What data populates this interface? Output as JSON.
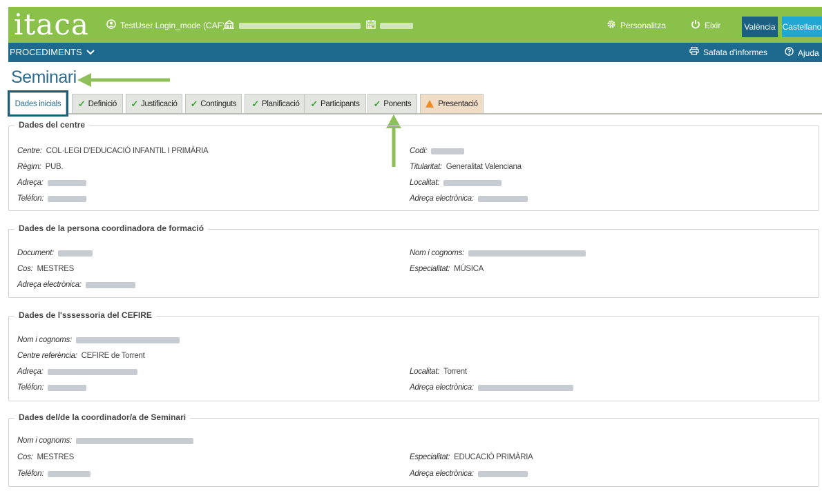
{
  "app": {
    "logo": "itaca",
    "user": "TestUser Login_mode (CAF)",
    "personalitza": "Personalitza",
    "eixir": "Eixir",
    "lang_active": "València",
    "lang_other": "Castellano",
    "brand_color": "#89c14a",
    "nav_color": "#1e6a8e"
  },
  "nav": {
    "procediments": "PROCEDIMENTS",
    "safata": "Safata d'informes",
    "ajuda": "Ajuda"
  },
  "page": {
    "title": "Seminari"
  },
  "tabs": [
    {
      "label": "Dades inicials",
      "state": "active"
    },
    {
      "label": "Definició",
      "state": "done"
    },
    {
      "label": "Justificació",
      "state": "done"
    },
    {
      "label": "Continguts",
      "state": "done"
    },
    {
      "label": "Planificació",
      "state": "done"
    },
    {
      "label": "Participants",
      "state": "done"
    },
    {
      "label": "Ponents",
      "state": "done"
    },
    {
      "label": "Presentació",
      "state": "warning"
    }
  ],
  "sections": {
    "centre": {
      "legend": "Dades del centre",
      "centre_label": "Centre:",
      "centre_value": "COL·LEGI D'EDUCACIÓ INFANTIL I PRIMÀRIA",
      "regim_label": "Règim:",
      "regim_value": "PUB.",
      "adreca_label": "Adreça:",
      "telefon_label": "Teléfon:",
      "codi_label": "Codi:",
      "titularitat_label": "Titularitat:",
      "titularitat_value": "Generalitat Valenciana",
      "localitat_label": "Localitat:",
      "email_label": "Adreça electrònica:"
    },
    "coordinadora": {
      "legend": "Dades de la persona coordinadora de formació",
      "document_label": "Document:",
      "cos_label": "Cos:",
      "cos_value": "MESTRES",
      "email_label": "Adreça electrònica:",
      "nom_label": "Nom i cognoms:",
      "especialitat_label": "Especialitat:",
      "especialitat_value": "MÚSICA"
    },
    "assessoria": {
      "legend": "Dades de l'sssessoria del CEFIRE",
      "nom_label": "Nom i cognoms:",
      "centre_ref_label": "Centre referència:",
      "centre_ref_value": "CEFIRE de Torrent",
      "adreca_label": "Adreça:",
      "telefon_label": "Teléfon:",
      "localitat_label": "Localitat:",
      "localitat_value": "Torrent",
      "email_label": "Adreça electrònica:"
    },
    "coordinador_seminari": {
      "legend": "Dades del/de la coordinador/a de Seminari",
      "nom_label": "Nom i cognoms:",
      "cos_label": "Cos:",
      "cos_value": "MESTRES",
      "telefon_label": "Teléfon:",
      "especialitat_label": "Especialitat:",
      "especialitat_value": "EDUCACIÓ PRIMÀRIA",
      "email_label": "Adreça electrònica:"
    }
  }
}
